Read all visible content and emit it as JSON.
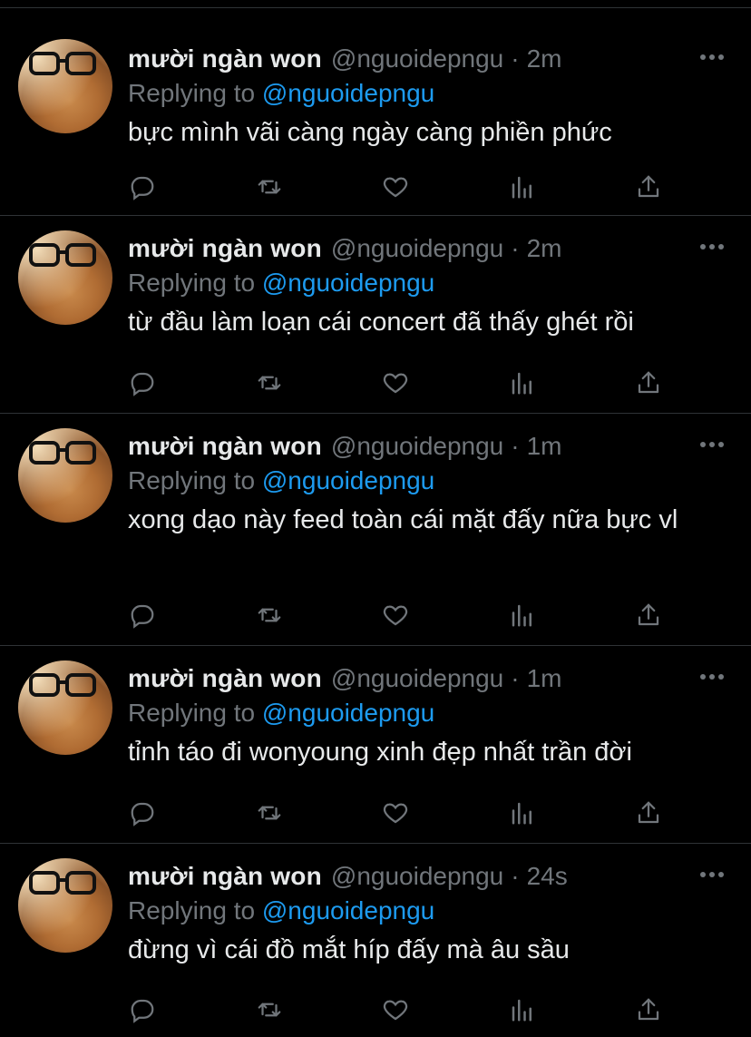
{
  "tweets": [
    {
      "author_name": "mười ngàn won",
      "handle": "@nguoidepngu",
      "separator": "·",
      "time": "2m",
      "replying_prefix": "Replying to",
      "replying_to": "@nguoidepngu",
      "text": "bực mình vãi càng ngày càng phiền phức"
    },
    {
      "author_name": "mười ngàn won",
      "handle": "@nguoidepngu",
      "separator": "·",
      "time": "2m",
      "replying_prefix": "Replying to",
      "replying_to": "@nguoidepngu",
      "text": "từ đầu làm loạn cái concert đã thấy ghét rồi"
    },
    {
      "author_name": "mười ngàn won",
      "handle": "@nguoidepngu",
      "separator": "·",
      "time": "1m",
      "replying_prefix": "Replying to",
      "replying_to": "@nguoidepngu",
      "text": "xong dạo này feed toàn cái mặt đấy nữa bực vl"
    },
    {
      "author_name": "mười ngàn won",
      "handle": "@nguoidepngu",
      "separator": "·",
      "time": "1m",
      "replying_prefix": "Replying to",
      "replying_to": "@nguoidepngu",
      "text": "tỉnh táo đi wonyoung xinh đẹp nhất trần đời"
    },
    {
      "author_name": "mười ngàn won",
      "handle": "@nguoidepngu",
      "separator": "·",
      "time": "24s",
      "replying_prefix": "Replying to",
      "replying_to": "@nguoidepngu",
      "text": "đừng vì cái đồ mắt híp đấy mà âu sầu"
    }
  ],
  "icons": {
    "more": "more-horizontal-icon",
    "reply": "reply-icon",
    "retweet": "retweet-icon",
    "like": "heart-icon",
    "views": "analytics-icon",
    "share": "share-icon"
  },
  "colors": {
    "background": "#000000",
    "text": "#e7e9ea",
    "secondary": "#71767b",
    "accent": "#1d9bf0",
    "divider": "#2f3336"
  }
}
